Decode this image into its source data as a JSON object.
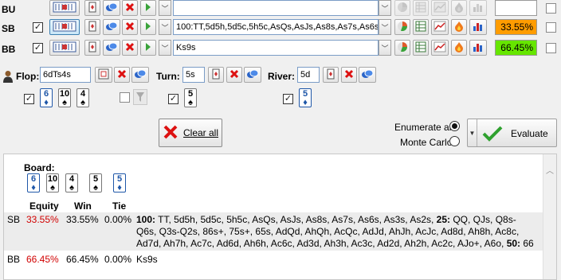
{
  "players": [
    {
      "label": "BU",
      "range": "",
      "equity": "",
      "equity_color": "#ffffff",
      "checked": false
    },
    {
      "label": "SB",
      "range": "100:TT,5d5h,5d5c,5h5c,AsQs,AsJs,As8s,As7s,As6s",
      "equity": "33.55%",
      "equity_color": "#ff9c00",
      "checked": true
    },
    {
      "label": "BB",
      "range": "Ks9s",
      "equity": "66.45%",
      "equity_color": "#66e600",
      "checked": true
    }
  ],
  "board_inputs": {
    "flop_label": "Flop:",
    "flop_value": "6dTs4s",
    "turn_label": "Turn:",
    "turn_value": "5s",
    "river_label": "River:",
    "river_value": "5d"
  },
  "flop_cards": [
    {
      "rank": "6",
      "suit": "♦",
      "color": "blue"
    },
    {
      "rank": "10",
      "suit": "♠",
      "color": "blk"
    },
    {
      "rank": "4",
      "suit": "♠",
      "color": "blk"
    }
  ],
  "turn_card": {
    "rank": "5",
    "suit": "♠",
    "color": "blk"
  },
  "river_card": {
    "rank": "5",
    "suit": "♦",
    "color": "blue"
  },
  "actions": {
    "clear_all": "Clear all",
    "enumerate_all": "Enumerate all",
    "monte_carlo": "Monte Carlo",
    "evaluate": "Evaluate"
  },
  "results": {
    "board_label": "Board:",
    "board_cards": [
      {
        "rank": "6",
        "suit": "♦",
        "color": "blue"
      },
      {
        "rank": "10",
        "suit": "♠",
        "color": "blk"
      },
      {
        "rank": "4",
        "suit": "♠",
        "color": "blk"
      },
      {
        "rank": "5",
        "suit": "♠",
        "color": "blk"
      },
      {
        "rank": "5",
        "suit": "♦",
        "color": "blue"
      }
    ],
    "headers": {
      "equity": "Equity",
      "win": "Win",
      "tie": "Tie"
    },
    "rows": [
      {
        "player": "SB",
        "equity": "33.55%",
        "win": "33.55%",
        "tie": "0.00%",
        "range_lines": [
          [
            {
              "b": "100:"
            },
            {
              "t": " TT, 5d5h, 5d5c, 5h5c, AsQs, AsJs, As8s, As7s, As6s, As3s, As2s, "
            },
            {
              "b": "25:"
            },
            {
              "t": " QQ, QJs, Q8s-"
            }
          ],
          [
            {
              "t": "Q6s, Q3s-Q2s, 86s+, 75s+, 65s, AdQd, AhQh, AcQc, AdJd, AhJh, AcJc, Ad8d, Ah8h, Ac8c,"
            }
          ],
          [
            {
              "t": "Ad7d, Ah7h, Ac7c, Ad6d, Ah6h, Ac6c, Ad3d, Ah3h, Ac3c, Ad2d, Ah2h, Ac2c, AJo+, A6o, "
            },
            {
              "b": "50:"
            },
            {
              "t": " 66"
            }
          ]
        ]
      },
      {
        "player": "BB",
        "equity": "66.45%",
        "win": "66.45%",
        "tie": "0.00%",
        "range_lines": [
          [
            {
              "t": "Ks9s"
            }
          ]
        ]
      }
    ]
  },
  "icons": [
    "card-range-icon",
    "single-card-icon",
    "chips-icon",
    "delete-icon",
    "arrow-icon",
    "pie-chart-icon",
    "table-icon",
    "graph-icon",
    "flame-icon",
    "bar-chart-icon",
    "player-icon",
    "filter-icon",
    "checkmark-icon"
  ]
}
